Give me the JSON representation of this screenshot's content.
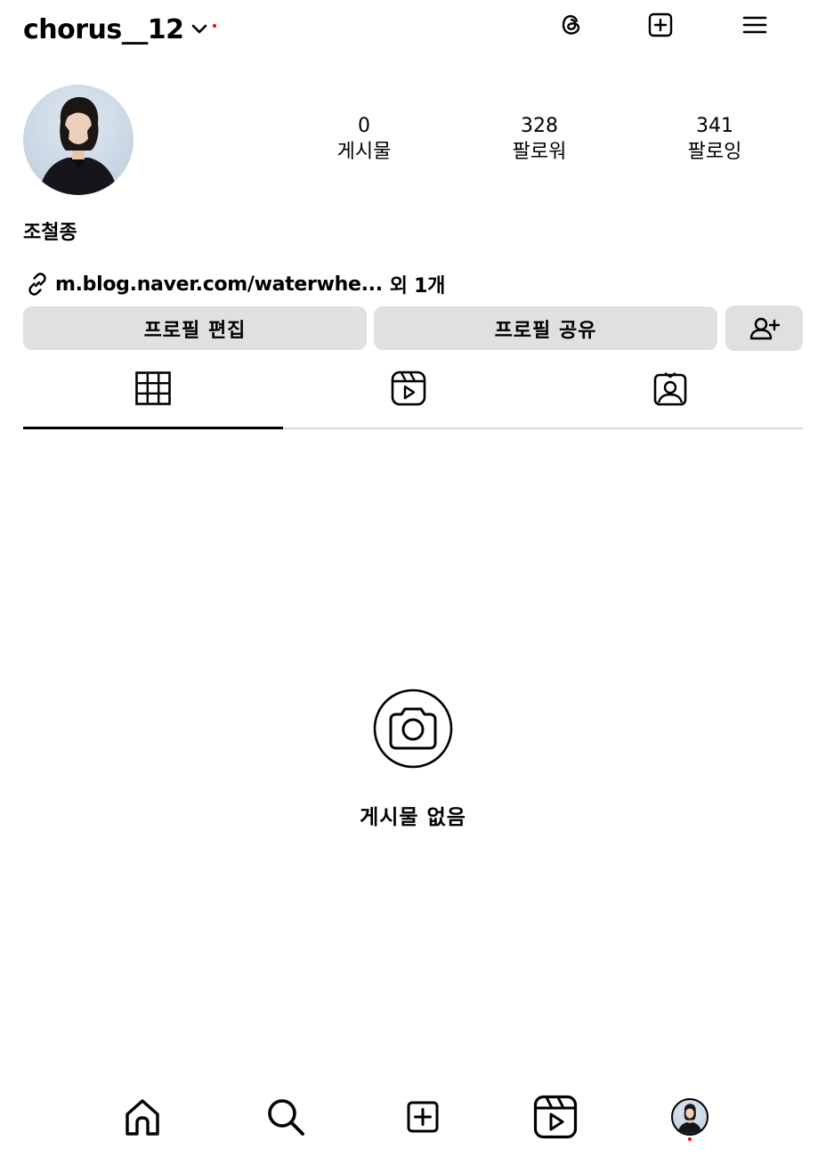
{
  "header": {
    "username": "chorus__12",
    "icons": [
      "chevron-down-icon",
      "threads-icon",
      "new-post-icon",
      "menu-icon"
    ],
    "notification_dot_color": "#ff0000"
  },
  "profile": {
    "avatar": "profile-photo",
    "display_name": "조철종",
    "stats": [
      {
        "value": "0",
        "label": "게시물"
      },
      {
        "value": "328",
        "label": "팔로워"
      },
      {
        "value": "341",
        "label": "팔로잉"
      }
    ],
    "link": {
      "text": "m.blog.naver.com/waterwhe...",
      "more": "외 1개"
    }
  },
  "actions": {
    "edit_profile": "프로필 편집",
    "share_profile": "프로필 공유",
    "add_person_icon": "person-add-icon"
  },
  "tabs": {
    "active": "grid",
    "items": [
      "grid-icon",
      "reels-icon",
      "tagged-icon"
    ]
  },
  "empty_state": {
    "icon": "camera-icon",
    "text": "게시물 없음"
  },
  "bottom_nav": {
    "items": [
      "home-icon",
      "search-icon",
      "new-post-icon",
      "reels-icon",
      "profile-avatar"
    ]
  },
  "colors": {
    "button_bg": "#e0e0e0",
    "divider": "#dbdbdb",
    "accent_dot": "#ff0000"
  }
}
